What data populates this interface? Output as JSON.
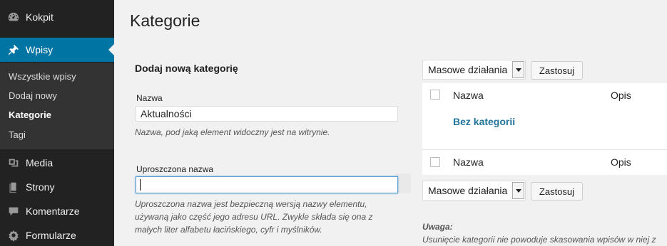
{
  "sidebar": {
    "items": [
      {
        "label": "Kokpit",
        "icon": "dashboard-icon"
      },
      {
        "label": "Wpisy",
        "icon": "pin-icon"
      },
      {
        "label": "Media",
        "icon": "media-icon"
      },
      {
        "label": "Strony",
        "icon": "pages-icon"
      },
      {
        "label": "Komentarze",
        "icon": "comments-icon"
      },
      {
        "label": "Formularze",
        "icon": "forms-icon"
      }
    ],
    "submenu": [
      "Wszystkie wpisy",
      "Dodaj nowy",
      "Kategorie",
      "Tagi"
    ]
  },
  "page": {
    "title": "Kategorie"
  },
  "form": {
    "title": "Dodaj nową kategorię",
    "name_label": "Nazwa",
    "name_value": "Aktualności",
    "name_desc": "Nazwa, pod jaką element widoczny jest na witrynie.",
    "slug_label": "Uproszczona nazwa",
    "slug_value": "",
    "slug_desc_1": "Uproszczona nazwa jest bezpieczną wersją nazwy elementu,",
    "slug_desc_2": "używaną jako część jego adresu URL. Zwykle składa się ona z",
    "slug_desc_3": "małych liter alfabetu łacińskiego, cyfr i myślników."
  },
  "list": {
    "bulk_actions": "Masowe działania",
    "apply": "Zastosuj",
    "col_name": "Nazwa",
    "col_desc": "Opis",
    "categories": [
      "Bez kategorii"
    ]
  },
  "note": {
    "title": "Uwaga:",
    "text": "Usunięcie kategorii nie powoduje skasowania wpisów w niej z"
  },
  "colors": {
    "sidebar_bg": "#222222",
    "active": "#0074a2",
    "link": "#21759b"
  }
}
